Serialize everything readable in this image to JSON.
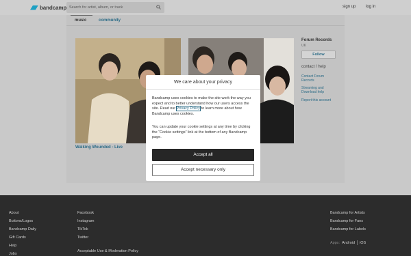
{
  "header": {
    "logo_text": "bandcamp",
    "search_placeholder": "Search for artist, album, or track",
    "signup": "sign up",
    "login": "log in"
  },
  "tabs": {
    "music": "music",
    "community": "community"
  },
  "photo_title": "Walking Wounded - Live",
  "sidebar": {
    "label_name": "Forum Records",
    "country": "UK",
    "follow": "Follow",
    "contact": "contact / help",
    "links": [
      "Contact Forum Records",
      "Streaming and Download help",
      "Report this account"
    ]
  },
  "modal": {
    "title": "We care about your privacy",
    "p1_before": "Bandcamp uses cookies to make the site work the way you expect and to better understand how our users access the site. Read our ",
    "p1_link": "Privacy Policy",
    "p1_after": " to learn more about how Bandcamp uses cookies.",
    "p2": "You can update your cookie settings at any time by clicking the “Cookie settings” link at the bottom of any Bandcamp page.",
    "accept_all": "Accept all",
    "accept_necessary": "Accept necessary only"
  },
  "footer": {
    "col1": [
      "About",
      "Buttons/Logos",
      "Bandcamp Daily",
      "Gift Cards",
      "Help",
      "Jobs"
    ],
    "col2": [
      "Facebook",
      "Instagram",
      "TikTok",
      "Twitter",
      "Acceptable Use & Moderation Policy"
    ],
    "col3": [
      "Bandcamp for Artists",
      "Bandcamp for Fans",
      "Bandcamp for Labels"
    ],
    "apps_label": "Apps:",
    "apps": [
      "Android",
      "iOS"
    ]
  },
  "colors": {
    "accent": "#2b6b86",
    "logo": "#1da0c3",
    "footer_bg": "#2c2c2c"
  }
}
